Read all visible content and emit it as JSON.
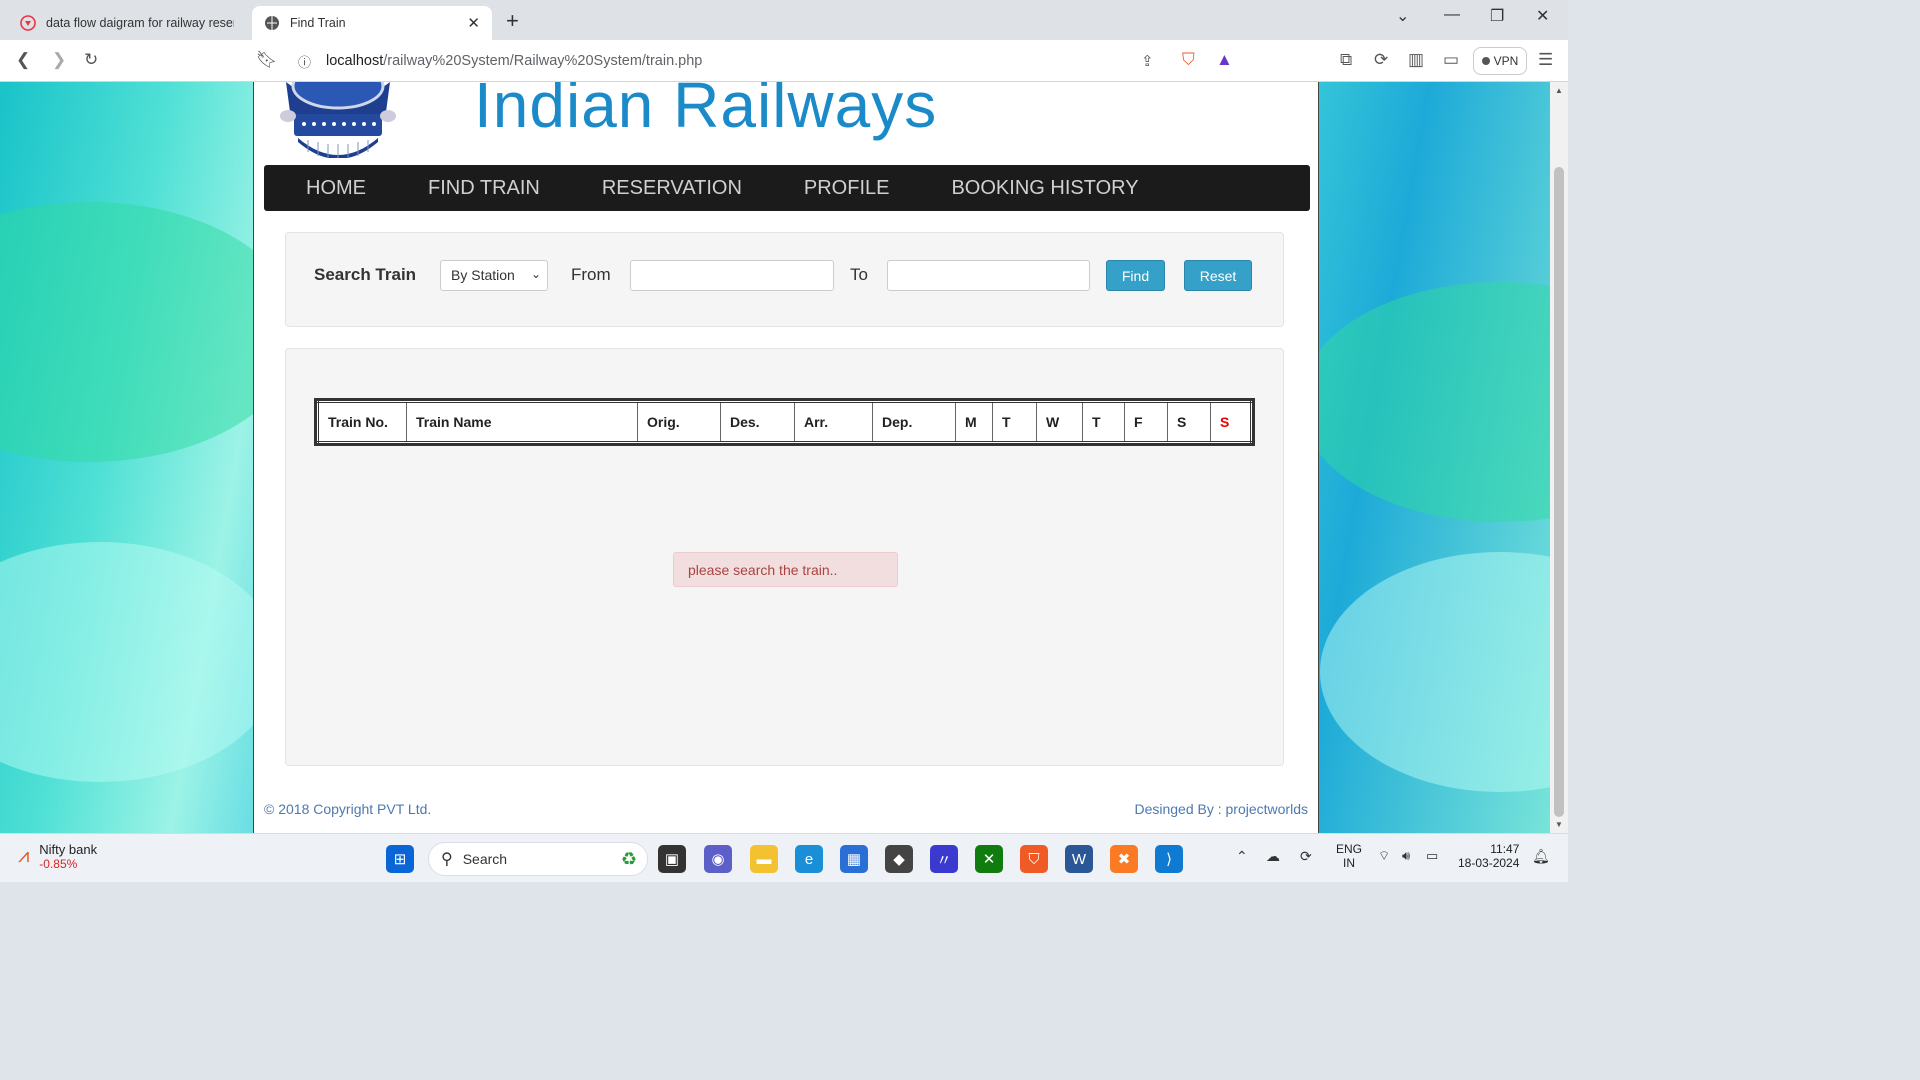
{
  "browser": {
    "tabs": [
      {
        "title": "data flow daigram for railway reserva",
        "active": false
      },
      {
        "title": "Find Train",
        "active": true
      }
    ],
    "new_tab": "+",
    "url_host": "localhost",
    "url_path": "/railway%20System/Railway%20System/train.php",
    "vpn_label": "VPN",
    "icons": [
      "back-icon",
      "forward-icon",
      "reload-icon",
      "bookmark-icon",
      "info-icon",
      "share-icon",
      "brave-shield-icon",
      "brave-rewards-icon",
      "extensions-icon",
      "sidebar-icon",
      "wallet-icon",
      "menu-icon"
    ]
  },
  "site": {
    "title": "Indian Railways",
    "logo_text": "INDIAN RAILWAYS",
    "nav": [
      "HOME",
      "FIND TRAIN",
      "RESERVATION",
      "PROFILE",
      "BOOKING HISTORY"
    ]
  },
  "search": {
    "label": "Search Train",
    "mode": "By Station",
    "from_label": "From",
    "from_value": "",
    "to_label": "To",
    "to_value": "",
    "find_label": "Find",
    "reset_label": "Reset"
  },
  "table": {
    "headers": [
      "Train No.",
      "Train Name",
      "Orig.",
      "Des.",
      "Arr.",
      "Dep.",
      "M",
      "T",
      "W",
      "T",
      "F",
      "S",
      "S"
    ]
  },
  "alert": "please search the train..",
  "footer": {
    "copyright": "© 2018 Copyright PVT Ltd.",
    "designed_by": "Desinged By : projectworlds"
  },
  "taskbar": {
    "widget_title": "Nifty bank",
    "widget_value": "-0.85%",
    "search_label": "Search",
    "lang1": "ENG",
    "lang2": "IN",
    "time": "11:47",
    "date": "18-03-2024"
  },
  "colors": {
    "accent": "#1b8ac8",
    "nav_bg": "#1b1b1b",
    "button": "#35a0c8",
    "alert_bg": "#f2dede",
    "alert_text": "#a94442"
  }
}
